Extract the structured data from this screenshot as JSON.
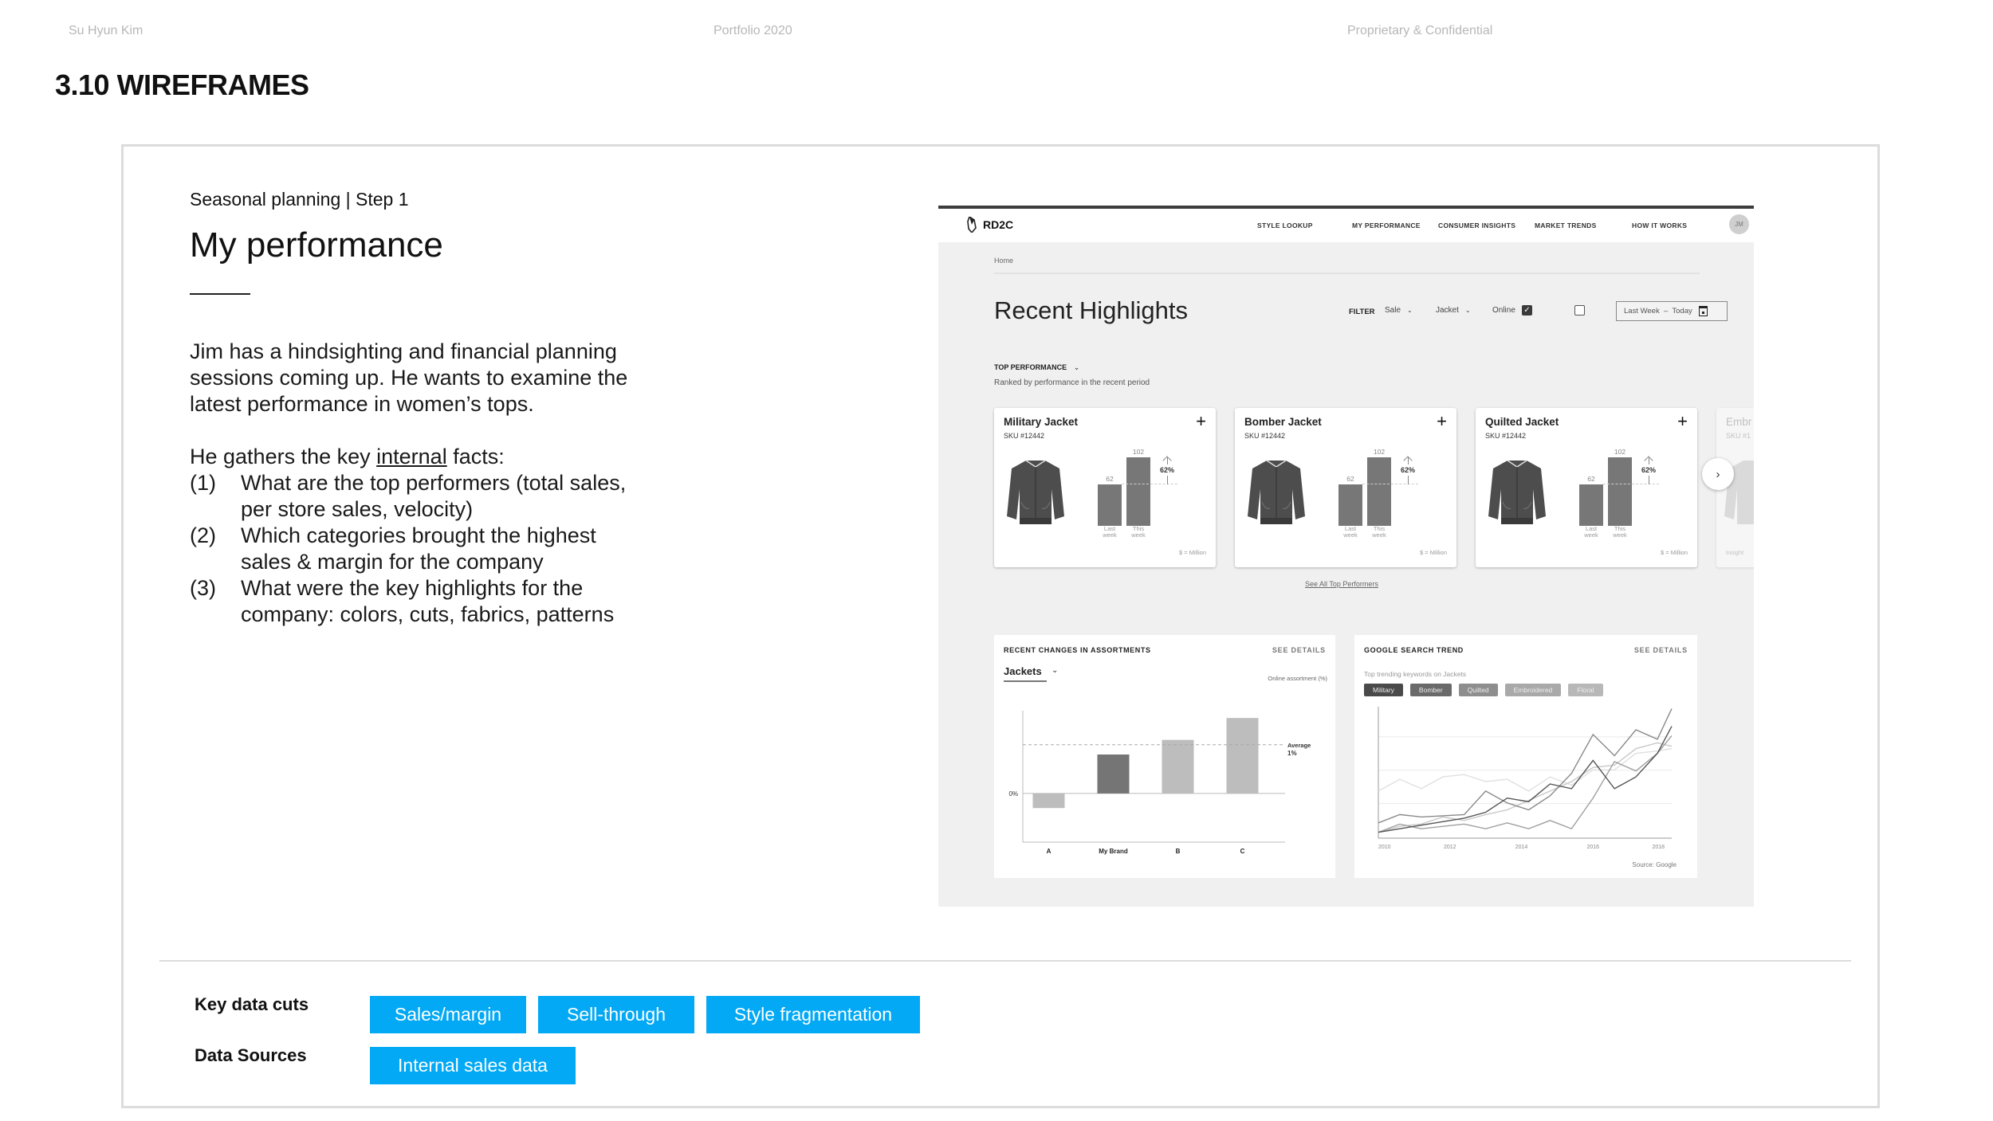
{
  "header": {
    "author": "Su Hyun Kim",
    "portfolio": "Portfolio 2020",
    "confidential": "Proprietary & Confidential",
    "section_title": "3.10 WIREFRAMES"
  },
  "story": {
    "step": "Seasonal planning | Step 1",
    "title": "My performance",
    "paragraph": "Jim has a hindsighting and financial planning sessions coming up. He wants to examine the latest performance in women’s tops.",
    "facts_prefix": "He gathers the key ",
    "facts_underlined": "internal",
    "facts_suffix": " facts:",
    "facts": [
      {
        "num": "(1)",
        "text": "What are the top performers (total sales, per store sales, velocity)"
      },
      {
        "num": "(2)",
        "text": "Which categories brought the highest sales & margin for the company"
      },
      {
        "num": "(3)",
        "text": "What were the key highlights for the company: colors, cuts, fabrics, patterns"
      }
    ]
  },
  "wireframe": {
    "logo": "RD2C",
    "nav": [
      "STYLE LOOKUP",
      "MY PERFORMANCE",
      "CONSUMER INSIGHTS",
      "MARKET TRENDS",
      "HOW IT WORKS"
    ],
    "avatar": "JM",
    "breadcrumb": "Home",
    "heading": "Recent Highlights",
    "filter": {
      "label": "FILTER",
      "dropdown1": "Sale",
      "dropdown2": "Jacket",
      "online_label": "Online",
      "online_checked": true,
      "second_checked": false,
      "date_range": "Last Week  –  Today"
    },
    "top_performance": {
      "label": "TOP PERFORMANCE",
      "subtitle": "Ranked by performance in the recent period",
      "cards": [
        {
          "name": "Military Jacket",
          "sku": "SKU #12442",
          "last_week": 62,
          "this_week": 102,
          "change": "62%",
          "last_label": "Last week",
          "this_label": "This week",
          "unit": "$ = Million"
        },
        {
          "name": "Bomber Jacket",
          "sku": "SKU #12442",
          "last_week": 62,
          "this_week": 102,
          "change": "62%",
          "last_label": "Last week",
          "this_label": "This week",
          "unit": "$ = Million"
        },
        {
          "name": "Quilted Jacket",
          "sku": "SKU #12442",
          "last_week": 62,
          "this_week": 102,
          "change": "62%",
          "last_label": "Last week",
          "this_label": "This week",
          "unit": "$ = Million"
        },
        {
          "name": "Embr",
          "sku": "SKU #1",
          "unit": "Insight"
        }
      ],
      "see_all": "See All Top Performers"
    },
    "assortments": {
      "title": "RECENT CHANGES IN ASSORTMENTS",
      "link": "SEE DETAILS",
      "dropdown": "Jackets",
      "axis_note": "Online assortment (%)"
    },
    "search_trend": {
      "title": "GOOGLE SEARCH TREND",
      "link": "SEE DETAILS",
      "subtitle": "Top trending keywords on Jackets",
      "keywords": [
        {
          "label": "Military",
          "color": "#4a4a4a"
        },
        {
          "label": "Bomber",
          "color": "#6a6a6a"
        },
        {
          "label": "Quilted",
          "color": "#8e8e8e"
        },
        {
          "label": "Embroidered",
          "color": "#a9a9a9"
        },
        {
          "label": "Floral",
          "color": "#b8b8b8"
        }
      ],
      "source": "Source: Google"
    }
  },
  "chart_data": [
    {
      "type": "bar",
      "title": "Recent changes in assortments",
      "categories": [
        "A",
        "My Brand",
        "B",
        "C"
      ],
      "values": [
        -0.3,
        0.8,
        1.1,
        1.55
      ],
      "colors": [
        "#bdbdbd",
        "#757575",
        "#bdbdbd",
        "#bdbdbd"
      ],
      "zero_label": "0%",
      "reference_line": {
        "label": "Average",
        "value_label": "1%",
        "value": 1.0
      },
      "ylim": [
        -1.0,
        1.7
      ],
      "ylabel": "Online assortment (%)"
    },
    {
      "type": "line",
      "title": "Google search trend",
      "x": [
        2010,
        2010.6,
        2011.2,
        2011.8,
        2012.4,
        2013,
        2013.6,
        2014.2,
        2014.8,
        2015.4,
        2016,
        2016.6,
        2017.2,
        2017.8,
        2018.2
      ],
      "x_ticks": [
        "2010",
        "2012",
        "2014",
        "2016",
        "2018"
      ],
      "xlim": [
        2010,
        2018.2
      ],
      "ylim": [
        0,
        100
      ],
      "grid": true,
      "series": [
        {
          "name": "Military",
          "color": "#555555",
          "values": [
            5,
            8,
            11,
            14,
            17,
            22,
            34,
            31,
            46,
            42,
            66,
            42,
            52,
            72,
            95
          ]
        },
        {
          "name": "Bomber",
          "color": "#8a8a8a",
          "values": [
            13,
            20,
            18,
            19,
            20,
            40,
            30,
            24,
            36,
            55,
            88,
            70,
            92,
            84,
            110
          ]
        },
        {
          "name": "Quilted",
          "color": "#a0a0a0",
          "values": [
            5,
            12,
            8,
            10,
            12,
            8,
            13,
            8,
            15,
            8,
            34,
            65,
            57,
            72,
            87
          ]
        },
        {
          "name": "Embroidered",
          "color": "#c8c8c8",
          "values": [
            5,
            10,
            12,
            18,
            15,
            20,
            24,
            32,
            40,
            48,
            60,
            62,
            76,
            81,
            78
          ]
        },
        {
          "name": "Floral",
          "color": "#e0e0e0",
          "values": [
            40,
            50,
            42,
            52,
            54,
            48,
            50,
            40,
            52,
            45,
            58,
            58,
            72,
            74,
            76
          ]
        }
      ]
    }
  ],
  "footer": {
    "key_data_cuts_label": "Key data cuts",
    "key_data_cuts": [
      "Sales/margin",
      "Sell-through",
      "Style fragmentation"
    ],
    "data_sources_label": "Data Sources",
    "data_sources": [
      "Internal sales data"
    ],
    "tag_color": "#03a9f4"
  }
}
